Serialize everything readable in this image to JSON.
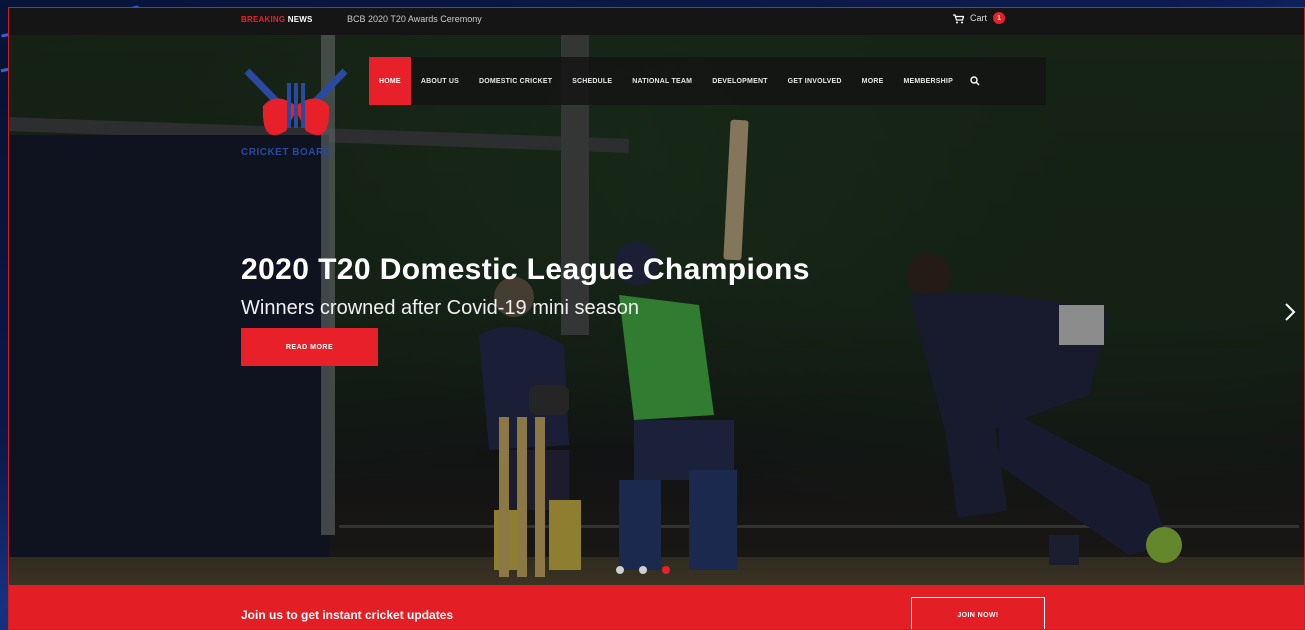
{
  "topbar": {
    "breaking_label_1": "BREAKING",
    "breaking_label_2": "NEWS",
    "ticker_text": "BCB 2020 T20 Awards Ceremony",
    "cart_label": "Cart",
    "cart_count": "1"
  },
  "logo": {
    "text": "CRICKET BOARD"
  },
  "nav": {
    "items": [
      {
        "label": "HOME",
        "active": true
      },
      {
        "label": "ABOUT US"
      },
      {
        "label": "DOMESTIC CRICKET"
      },
      {
        "label": "SCHEDULE"
      },
      {
        "label": "NATIONAL TEAM"
      },
      {
        "label": "DEVELOPMENT"
      },
      {
        "label": "GET INVOLVED"
      },
      {
        "label": "MORE"
      },
      {
        "label": "MEMBERSHIP"
      }
    ],
    "search_icon": "search-icon"
  },
  "slide": {
    "title": "2020 T20 Domestic League Champions",
    "subtitle": "Winners crowned after Covid-19 mini season",
    "cta_label": "READ MORE",
    "active_index": 2,
    "total": 3
  },
  "banner": {
    "text": "Join us to get instant cricket updates",
    "button_label": "JOIN NOW!"
  },
  "colors": {
    "accent": "#e8202a",
    "topbar_bg": "#151515",
    "banner_bg": "#e31e24"
  }
}
